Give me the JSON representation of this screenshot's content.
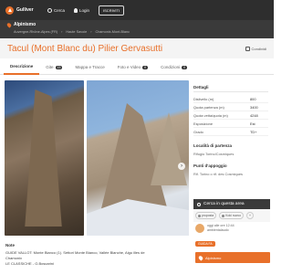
{
  "app": {
    "name": "Gulliver"
  },
  "topnav": {
    "search": "Cerca",
    "login": "Login",
    "signup": "ISCRIVITI"
  },
  "breadcrumb": {
    "section": "Alpinismo",
    "path": [
      "Auvergne-Rhône-Alpes (FR)",
      "Haute Savoie",
      "Chamonix-Mont-Blanc"
    ]
  },
  "page": {
    "title": "Tacul (Mont Blanc du) Pilier Gervasutti",
    "share": "Condividi"
  },
  "tabs": [
    {
      "label": "Descrizione",
      "badge": ""
    },
    {
      "label": "Gite",
      "badge": "15"
    },
    {
      "label": "Mappa e Tracce",
      "badge": ""
    },
    {
      "label": "Foto e Video",
      "badge": "0"
    },
    {
      "label": "Condizioni",
      "badge": "0"
    }
  ],
  "details": {
    "title": "Dettagli",
    "rows": [
      {
        "label": "Dislivello (m)",
        "value": "800"
      },
      {
        "label": "Quota partenza (m)",
        "value": "3400"
      },
      {
        "label": "Quota vetta/quota (m)",
        "value": "4248"
      },
      {
        "label": "Esposizione",
        "value": "Est"
      },
      {
        "label": "Grado",
        "value": "TD+"
      }
    ],
    "start_title": "Località di partenza",
    "start_value": "Rifugio Torino/Cosmiques",
    "support_title": "Punti d'appoggio",
    "support_value": "Rif. Torino o rif. des Cosmiques"
  },
  "nearby": {
    "title": "Cerca in questa area",
    "filters": [
      "proposta",
      "Koki nuovo",
      "+"
    ]
  },
  "recent": {
    "user_meta": "oggi alle ore 12:44",
    "username": "ambientalaudo",
    "badge": "GUIDA FA",
    "route_label": "Alpinismo"
  },
  "notes": {
    "title": "Note",
    "lines": [
      "GUIDE VALLOT: Monte Bianco (1). Settori Monte Bianco, Vallée Blanche, Aigu illes de",
      "Chamonix",
      "LE CLASSICHE - G.Boscarini"
    ]
  },
  "colors": {
    "accent": "#e8702a",
    "topbar": "#2e2e2e",
    "crumbs": "#3a3a3a"
  },
  "icons": {
    "share": "share-icon",
    "search": "search-icon",
    "user": "user-icon",
    "next": "chevron-right-icon"
  }
}
